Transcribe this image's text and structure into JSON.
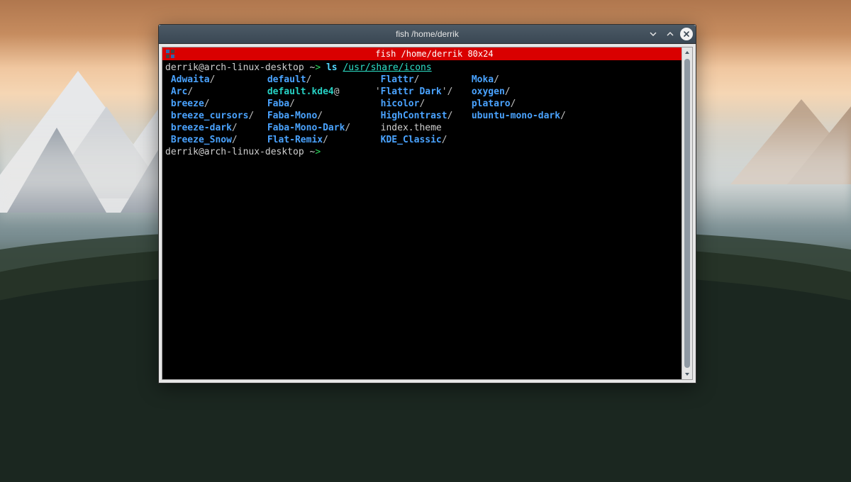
{
  "window": {
    "title": "fish /home/derrik",
    "controls": {
      "minimize_name": "minimize-button",
      "maximize_name": "maximize-button",
      "close_name": "close-button"
    }
  },
  "tab": {
    "label": "fish  /home/derrik 80x24"
  },
  "prompt": {
    "user_host": "derrik@arch-linux-desktop",
    "tilde": "~",
    "arrow": ">",
    "command": "ls",
    "arg": "/usr/share/icons"
  },
  "prompt2": {
    "user_host": "derrik@arch-linux-desktop",
    "tilde": "~",
    "arrow": ">"
  },
  "listing": {
    "col0": [
      {
        "name": "Adwaita",
        "kind": "dir"
      },
      {
        "name": "Arc",
        "kind": "dir"
      },
      {
        "name": "breeze",
        "kind": "dir"
      },
      {
        "name": "breeze_cursors",
        "kind": "dir"
      },
      {
        "name": "breeze-dark",
        "kind": "dir"
      },
      {
        "name": "Breeze_Snow",
        "kind": "dir"
      }
    ],
    "col1": [
      {
        "name": "default",
        "kind": "dir"
      },
      {
        "name": "default.kde4",
        "kind": "symlink"
      },
      {
        "name": "Faba",
        "kind": "dir"
      },
      {
        "name": "Faba-Mono",
        "kind": "dir"
      },
      {
        "name": "Faba-Mono-Dark",
        "kind": "dir"
      },
      {
        "name": "Flat-Remix",
        "kind": "dir"
      }
    ],
    "col2": [
      {
        "name": "Flattr",
        "kind": "dir",
        "leading_space": true
      },
      {
        "name": "Flattr Dark",
        "kind": "dir",
        "quoted": true
      },
      {
        "name": "hicolor",
        "kind": "dir",
        "leading_space": true
      },
      {
        "name": "HighContrast",
        "kind": "dir",
        "leading_space": true
      },
      {
        "name": "index.theme",
        "kind": "file",
        "leading_space": true
      },
      {
        "name": "KDE_Classic",
        "kind": "dir",
        "leading_space": true
      }
    ],
    "col3": [
      {
        "name": "Moka",
        "kind": "dir"
      },
      {
        "name": "oxygen",
        "kind": "dir"
      },
      {
        "name": "plataro",
        "kind": "dir"
      },
      {
        "name": "ubuntu-mono-dark",
        "kind": "dir"
      }
    ]
  },
  "colors": {
    "titlebar_bg": "#3a4753",
    "tab_bg": "#d90000",
    "terminal_bg": "#000000",
    "dir": "#4aa3ff",
    "symlink": "#26d1c4",
    "cmd_arg": "#2de0c8",
    "prompt_arrow": "#2bd65c"
  }
}
